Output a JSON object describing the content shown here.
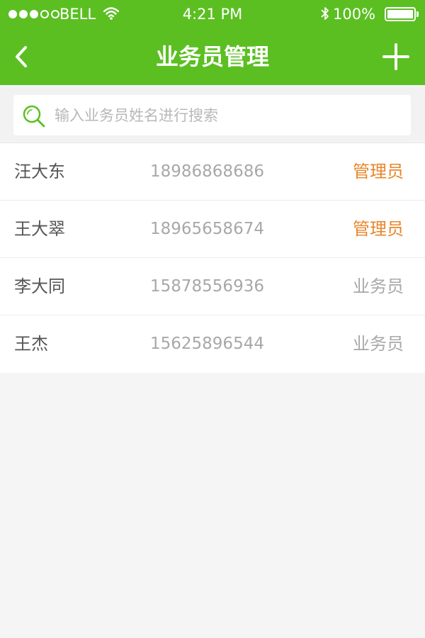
{
  "status_bar": {
    "carrier": "BELL",
    "time": "4:21 PM",
    "battery_percent": "100%",
    "battery_level": 1.0,
    "signal_strength": 3,
    "signal_max": 5,
    "wifi_icon": "wifi-icon",
    "bluetooth_icon": "bluetooth-icon"
  },
  "nav": {
    "title": "业务员管理",
    "back_icon": "chevron-left-icon",
    "add_icon": "plus-icon"
  },
  "search": {
    "placeholder": "输入业务员姓名进行搜索",
    "value": "",
    "icon": "search-icon"
  },
  "salesmen": [
    {
      "name": "汪大东",
      "phone": "18986868686",
      "role": "管理员",
      "role_color": "#e8862a"
    },
    {
      "name": "王大翠",
      "phone": "18965658674",
      "role": "管理员",
      "role_color": "#e8862a"
    },
    {
      "name": "李大同",
      "phone": "15878556936",
      "role": "业务员",
      "role_color": "#a8a8a8"
    },
    {
      "name": "王杰",
      "phone": "15625896544",
      "role": "业务员",
      "role_color": "#a8a8a8"
    }
  ],
  "colors": {
    "header_green": "#5bbf22",
    "admin_orange": "#e8862a",
    "muted_gray": "#a8a8a8",
    "background": "#f5f5f5"
  }
}
